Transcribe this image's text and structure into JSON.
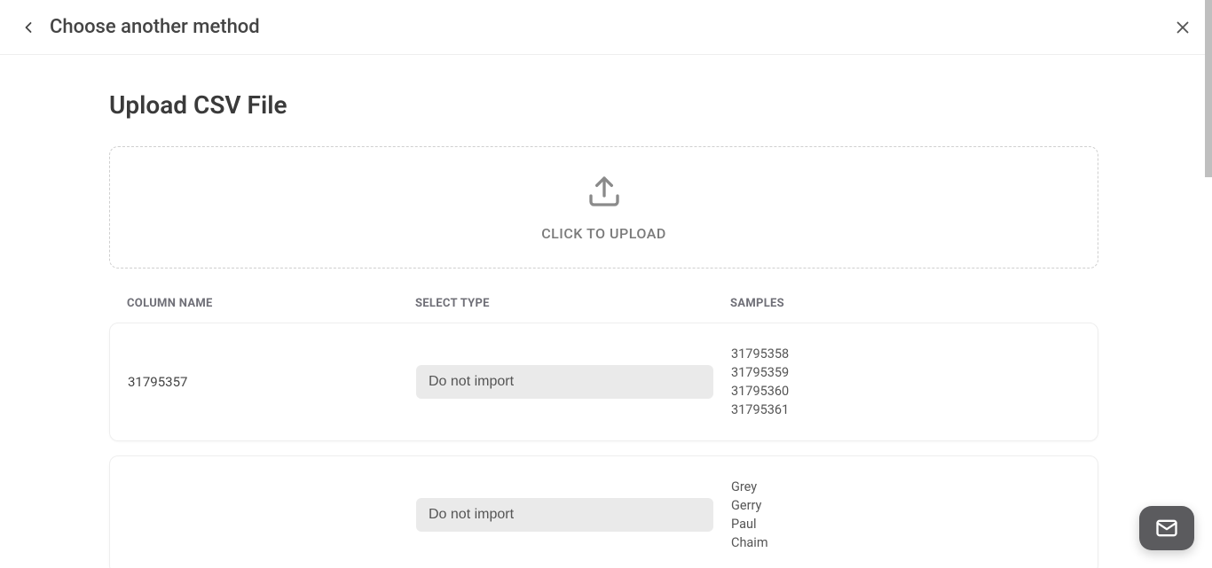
{
  "header": {
    "back_label": "Choose another method"
  },
  "page": {
    "title": "Upload CSV File"
  },
  "upload": {
    "label": "CLICK TO UPLOAD"
  },
  "columns": {
    "name_header": "COLUMN NAME",
    "type_header": "SELECT TYPE",
    "samples_header": "SAMPLES"
  },
  "rows": [
    {
      "column_name": "31795357",
      "select_type": "Do not import",
      "samples": [
        "31795358",
        "31795359",
        "31795360",
        "31795361"
      ]
    },
    {
      "column_name": "",
      "select_type": "Do not import",
      "samples": [
        "Grey",
        "Gerry",
        "Paul",
        "Chaim"
      ]
    }
  ]
}
